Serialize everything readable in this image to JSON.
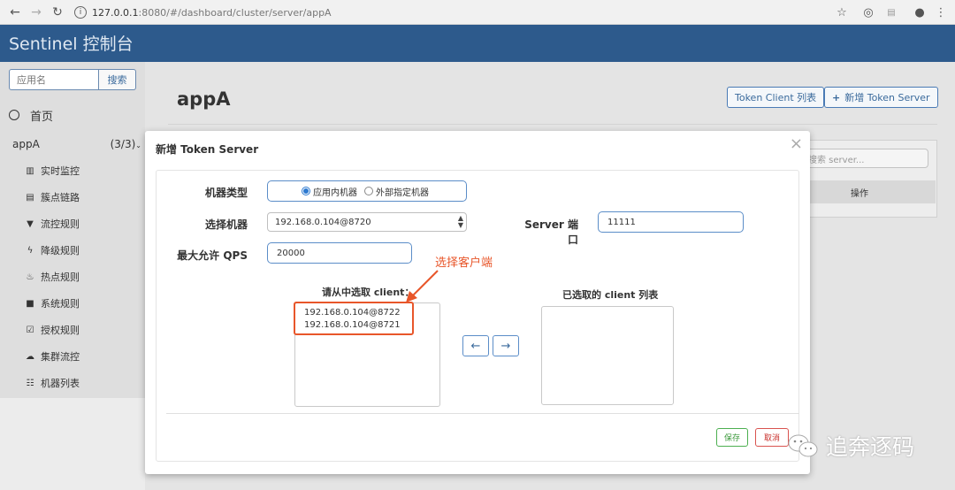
{
  "browser": {
    "url_host": "127.0.0.1",
    "url_rest": ":8080/#/dashboard/cluster/server/appA"
  },
  "app": {
    "brand": "Sentinel 控制台"
  },
  "sidebar": {
    "search_placeholder": "应用名",
    "search_button": "搜索",
    "home_label": "首页",
    "app_name": "appA",
    "app_count": "(3/3)",
    "items": [
      {
        "label": "实时监控",
        "icon": "bar-chart-icon"
      },
      {
        "label": "簇点链路",
        "icon": "list-icon"
      },
      {
        "label": "流控规则",
        "icon": "filter-icon"
      },
      {
        "label": "降级规则",
        "icon": "flash-icon"
      },
      {
        "label": "热点规则",
        "icon": "fire-icon"
      },
      {
        "label": "系统规则",
        "icon": "lock-icon"
      },
      {
        "label": "授权规则",
        "icon": "check-circle-icon"
      },
      {
        "label": "集群流控",
        "icon": "cloud-icon"
      },
      {
        "label": "机器列表",
        "icon": "table-icon"
      }
    ]
  },
  "main": {
    "title": "appA",
    "token_client_list_btn": "Token Client 列表",
    "add_token_server_btn": "新增 Token Server",
    "panel_search_placeholder": "搜索 server...",
    "table_header_ops": "操作"
  },
  "modal": {
    "title": "新增 Token Server",
    "machine_type_label": "机器类型",
    "machine_type_options": [
      "应用内机器",
      "外部指定机器"
    ],
    "machine_type_selected": "应用内机器",
    "select_machine_label": "选择机器",
    "select_machine_value": "192.168.0.104@8720",
    "server_port_label": "Server 端口",
    "server_port_value": "11111",
    "max_qps_label": "最大允许 QPS",
    "max_qps_value": "20000",
    "available_title": "请从中选取 client：",
    "available_clients": [
      "192.168.0.104@8722",
      "192.168.0.104@8721"
    ],
    "selected_title": "已选取的 client 列表",
    "selected_clients": [],
    "move_left": "←",
    "move_right": "→",
    "save": "保存",
    "cancel": "取消"
  },
  "annotation": {
    "text": "选择客户端",
    "color": "#e8562a"
  },
  "watermark": {
    "text": "追奔逐码"
  },
  "colors": {
    "header": "#2d5a8c",
    "accent": "#5b8dc8",
    "save": "#4caf50",
    "cancel": "#d9534f"
  }
}
